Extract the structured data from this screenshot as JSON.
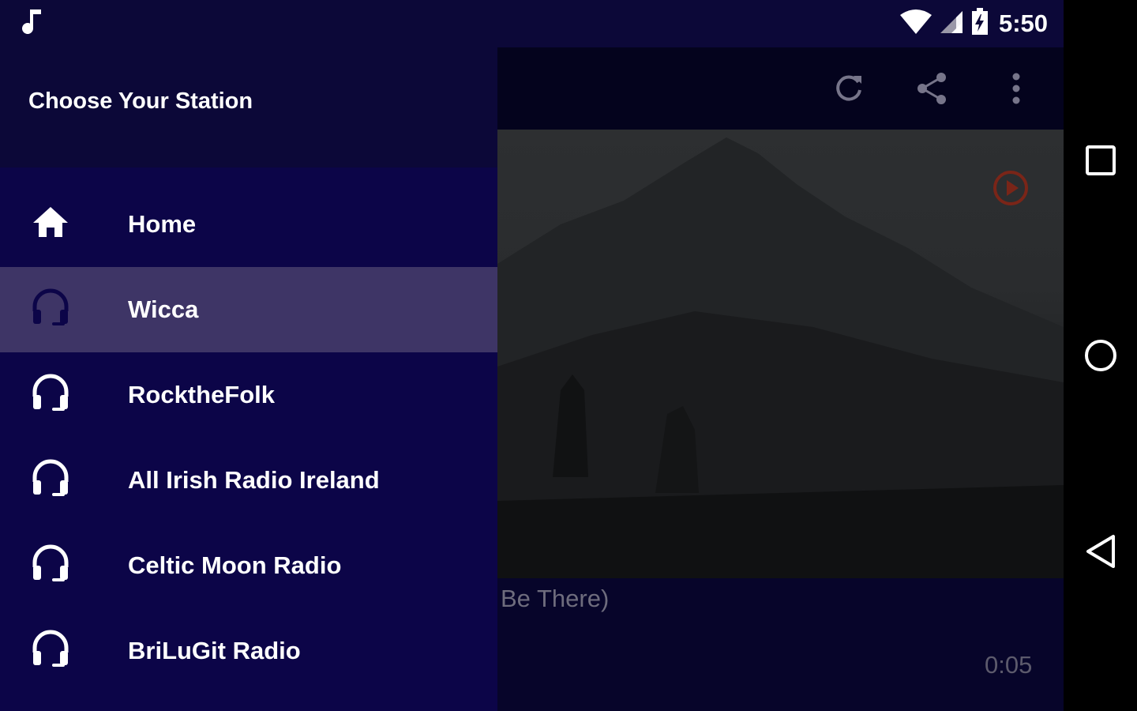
{
  "status_bar": {
    "time": "5:50",
    "icons": [
      "music-note-icon",
      "wifi-icon",
      "cell-signal-icon",
      "battery-charging-icon"
    ]
  },
  "toolbar": {
    "icons": [
      "refresh-icon",
      "share-icon",
      "more-vert-icon"
    ]
  },
  "player": {
    "track_title": "Be There)",
    "elapsed": "0:05",
    "play_icon": "play-circle-icon"
  },
  "drawer": {
    "title": "Choose Your Station",
    "items": [
      {
        "label": "Home",
        "icon": "home-icon",
        "selected": false
      },
      {
        "label": "Wicca",
        "icon": "headphones-icon",
        "selected": true
      },
      {
        "label": "RocktheFolk",
        "icon": "headphones-icon",
        "selected": false
      },
      {
        "label": "All Irish Radio Ireland",
        "icon": "headphones-icon",
        "selected": false
      },
      {
        "label": "Celtic Moon Radio",
        "icon": "headphones-icon",
        "selected": false
      },
      {
        "label": "BriLuGit Radio",
        "icon": "headphones-icon",
        "selected": false
      }
    ]
  },
  "nav_bar": {
    "buttons": [
      "recents-icon",
      "home-circle-icon",
      "back-icon"
    ]
  },
  "colors": {
    "drawer_bg": "#0c0548",
    "drawer_header_bg": "#0c0838",
    "selected_bg": "#3e3566",
    "accent_play": "#8a2a1e"
  }
}
